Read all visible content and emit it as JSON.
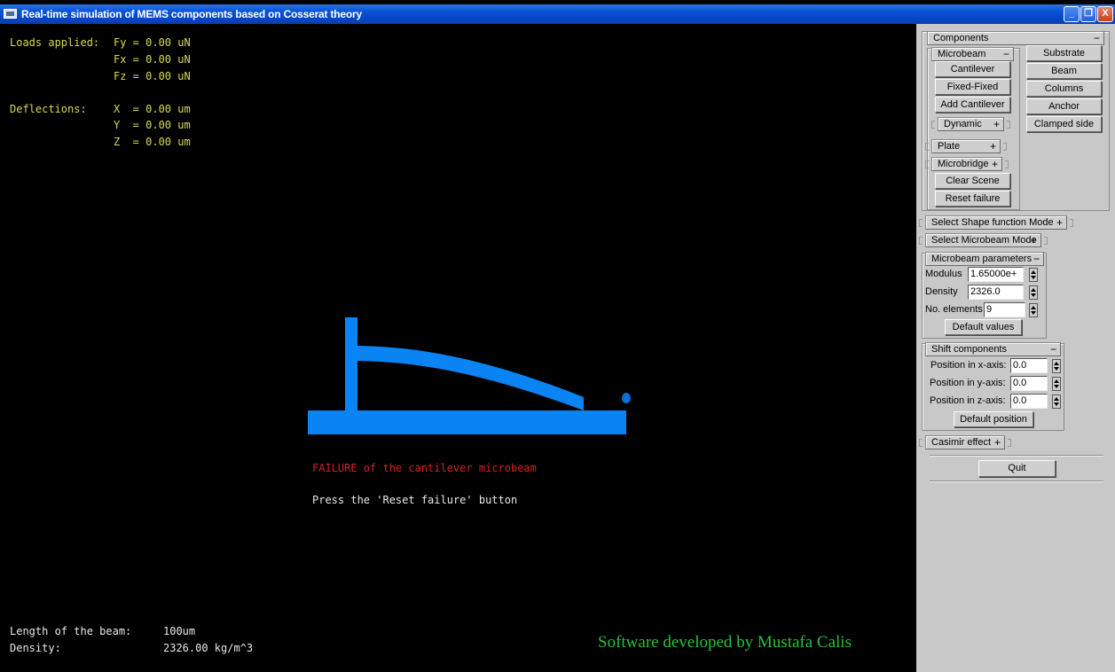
{
  "window": {
    "title": "Real-time simulation of MEMS components based on Cosserat theory",
    "minimize_symbol": "_",
    "restore_symbol": "❐",
    "close_symbol": "X"
  },
  "hud": {
    "loads_label": "Loads applied:",
    "fy": "Fy = 0.00 uN",
    "fx": "Fx = 0.00 uN",
    "fz": "Fz = 0.00 uN",
    "deflections_label": "Deflections:",
    "x": "X  = 0.00 um",
    "y": "Y  = 0.00 um",
    "z": "Z  = 0.00 um",
    "failure_message": "FAILURE of the cantilever microbeam",
    "reset_hint": "Press the 'Reset failure' button",
    "beam_length_label": "Length of the beam:",
    "beam_length_value": "100um",
    "density_label": "Density:",
    "density_value": "2326.00 kg/m^3",
    "credit": "Software developed by Mustafa Calis"
  },
  "panel": {
    "components": {
      "title": "Components",
      "sign": "−",
      "microbeam": {
        "title": "Microbeam",
        "sign": "−"
      },
      "cantilever": "Cantilever",
      "fixed_fixed": "Fixed-Fixed",
      "add_cantilever": "Add Cantilever",
      "dynamic": {
        "title": "Dynamic",
        "sign": "+"
      },
      "plate": {
        "title": "Plate",
        "sign": "+"
      },
      "microbridge": {
        "title": "Microbridge",
        "sign": "+"
      },
      "clear_scene": "Clear Scene",
      "reset_failure": "Reset failure",
      "substrate": "Substrate",
      "beam": "Beam",
      "columns": "Columns",
      "anchor": "Anchor",
      "clamped_side": "Clamped side"
    },
    "shape_function_mode": {
      "title": "Select Shape function Mode",
      "sign": "+"
    },
    "microbeam_mode": {
      "title": "Select Microbeam Mode",
      "sign": "+"
    },
    "microbeam_parameters": {
      "title": "Microbeam parameters",
      "sign": "−",
      "modulus_label": "Modulus",
      "modulus_value": "1.65000e+",
      "density_label": "Density",
      "density_value": "2326.0",
      "elements_label": "No. elements",
      "elements_value": "9",
      "default_values": "Default values"
    },
    "shift_components": {
      "title": "Shift components",
      "sign": "−",
      "x_label": "Position in x-axis:",
      "x_value": "0.0",
      "y_label": "Position in y-axis:",
      "y_value": "0.0",
      "z_label": "Position in z-axis:",
      "z_value": "0.0",
      "default_position": "Default position"
    },
    "casimir_effect": {
      "title": "Casimir effect",
      "sign": "+"
    },
    "quit": "Quit"
  },
  "colors": {
    "scene_blue": "#0a84f2",
    "hud_yellow": "#d8d85a",
    "failure_red": "#d62020",
    "credit_green": "#27c23a"
  }
}
